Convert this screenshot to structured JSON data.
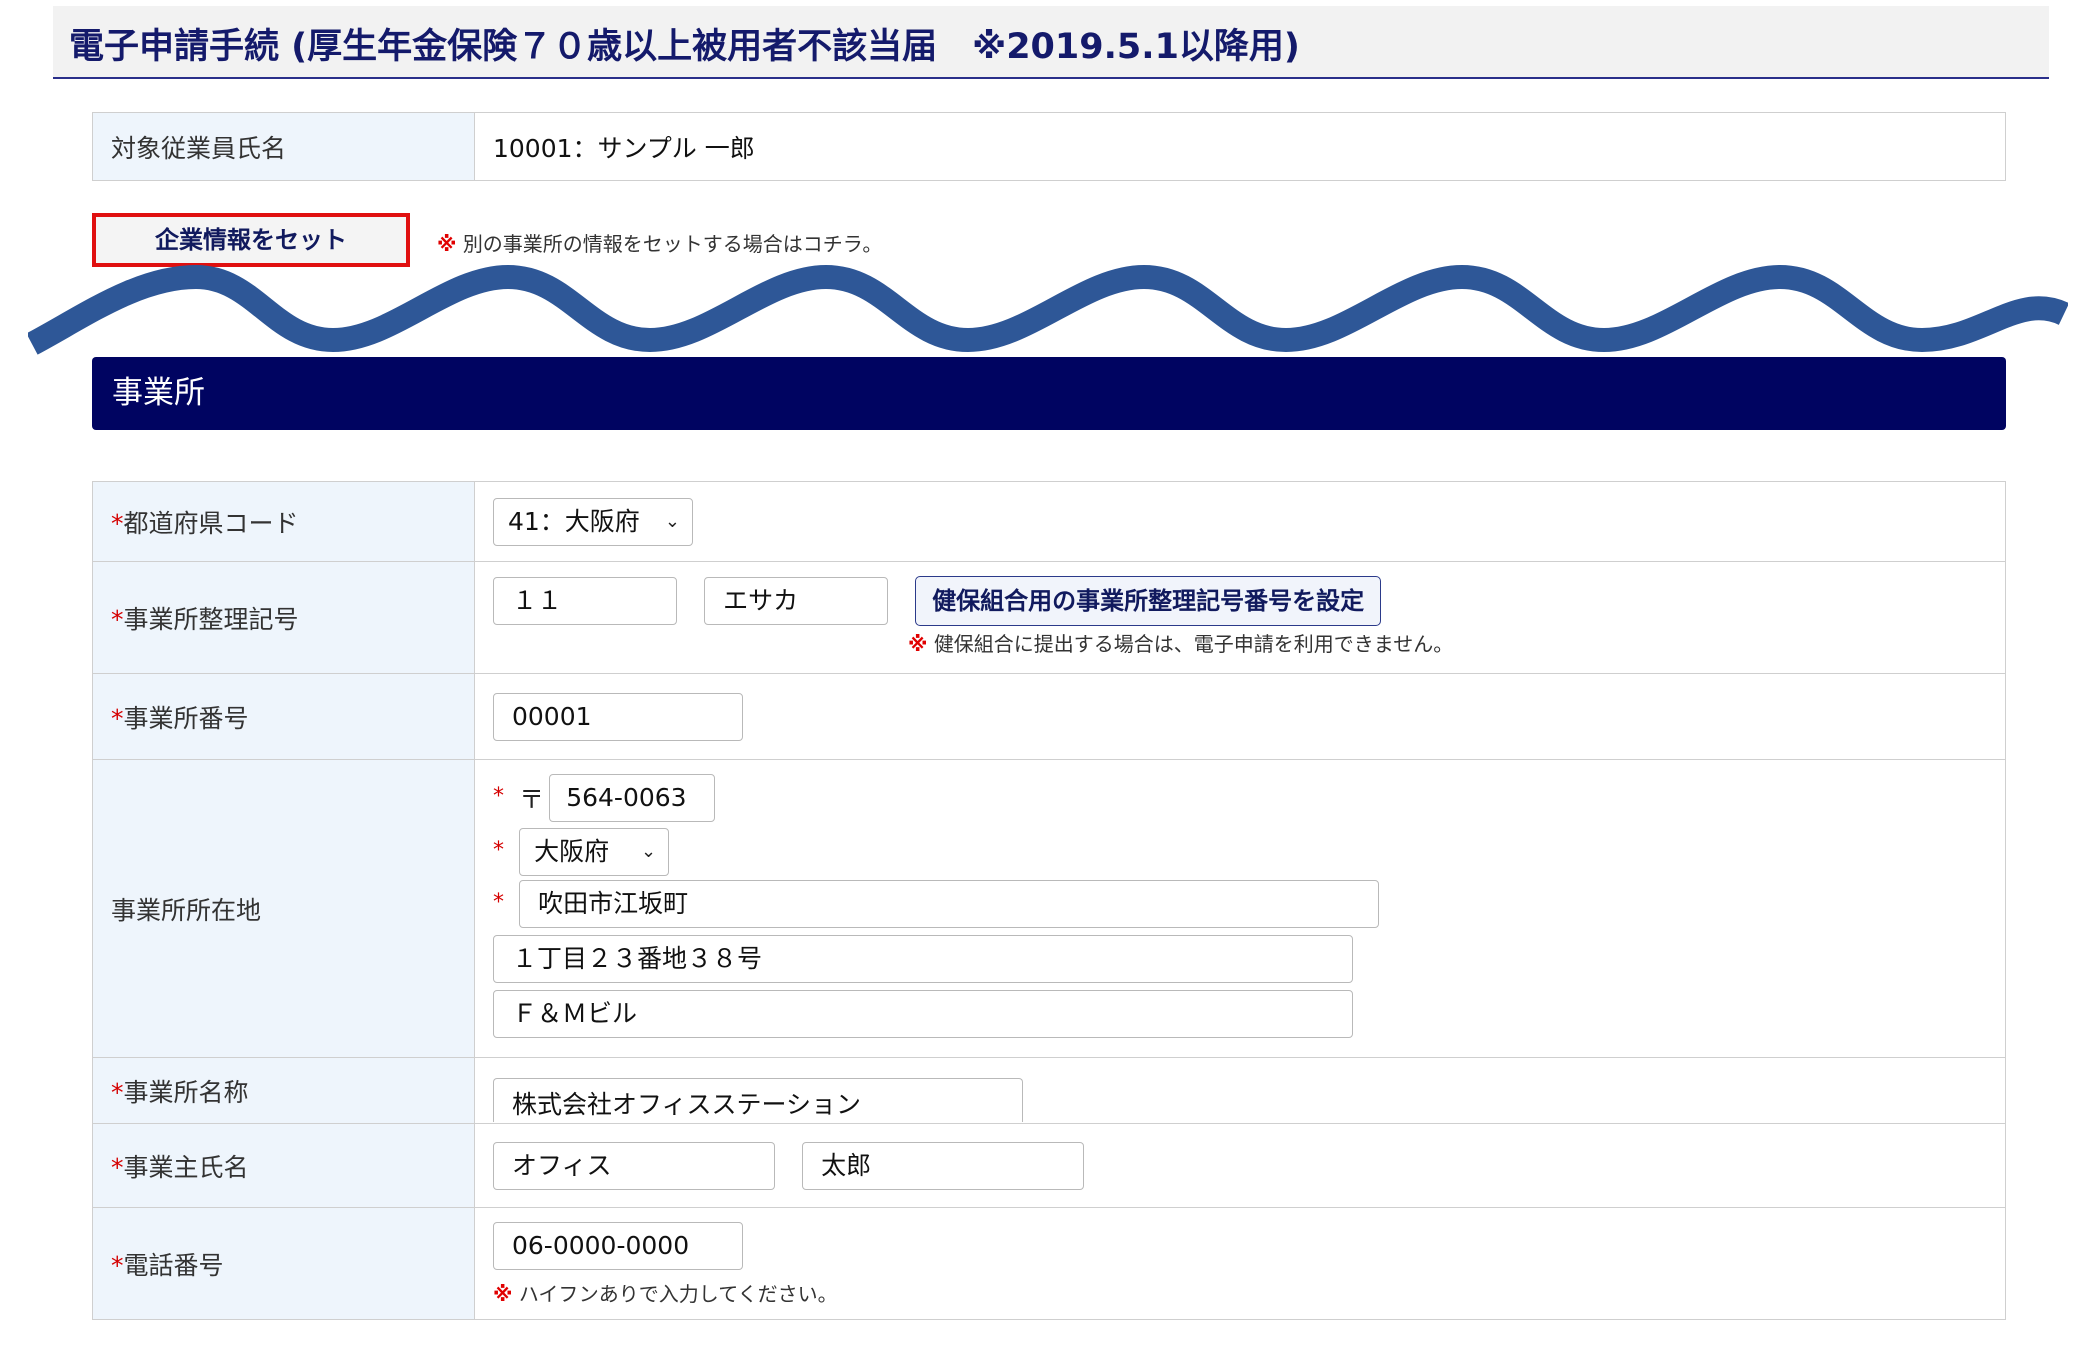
{
  "page_title": "電子申請手続 (厚生年金保険７０歳以上被用者不該当届　※2019.5.1以降用)",
  "employee": {
    "label": "対象従業員氏名",
    "value": "10001：サンプル 一郎"
  },
  "set_company": {
    "button_label": "企業情報をセット",
    "note_mark": "※",
    "note_text": "別の事業所の情報をセットする場合はコチラ。"
  },
  "section_title": "事業所",
  "required_mark": "*",
  "form": {
    "prefecture_code": {
      "label": "都道府県コード",
      "value": "41：大阪府"
    },
    "office_ref_symbol": {
      "label": "事業所整理記号",
      "value1": "１１",
      "value2": "エサカ",
      "button_label": "健保組合用の事業所整理記号番号を設定",
      "note_mark": "※",
      "note_text": "健保組合に提出する場合は、電子申請を利用できません。"
    },
    "office_number": {
      "label": "事業所番号",
      "value": "00001"
    },
    "office_address": {
      "label": "事業所所在地",
      "postal_mark": "〒",
      "postal_code": "564-0063",
      "prefecture": "大阪府",
      "city": "吹田市江坂町",
      "street": "１丁目２３番地３８号",
      "building": "Ｆ＆Ｍビル"
    },
    "office_name": {
      "label": "事業所名称",
      "value": "株式会社オフィスステーション"
    },
    "owner_name": {
      "label": "事業主氏名",
      "last": "オフィス",
      "first": "太郎"
    },
    "phone": {
      "label": "電話番号",
      "value": "06-0000-0000",
      "note_mark": "※",
      "note_text": "ハイフンありで入力してください。"
    }
  },
  "colors": {
    "title_text": "#141a6b",
    "section_bg": "#000461",
    "wave": "#2e5797",
    "required": "#d40000",
    "highlight_border": "#e01010",
    "label_bg": "#eef5fc"
  },
  "icons": {
    "select_arrow": "chevron-down-icon"
  }
}
